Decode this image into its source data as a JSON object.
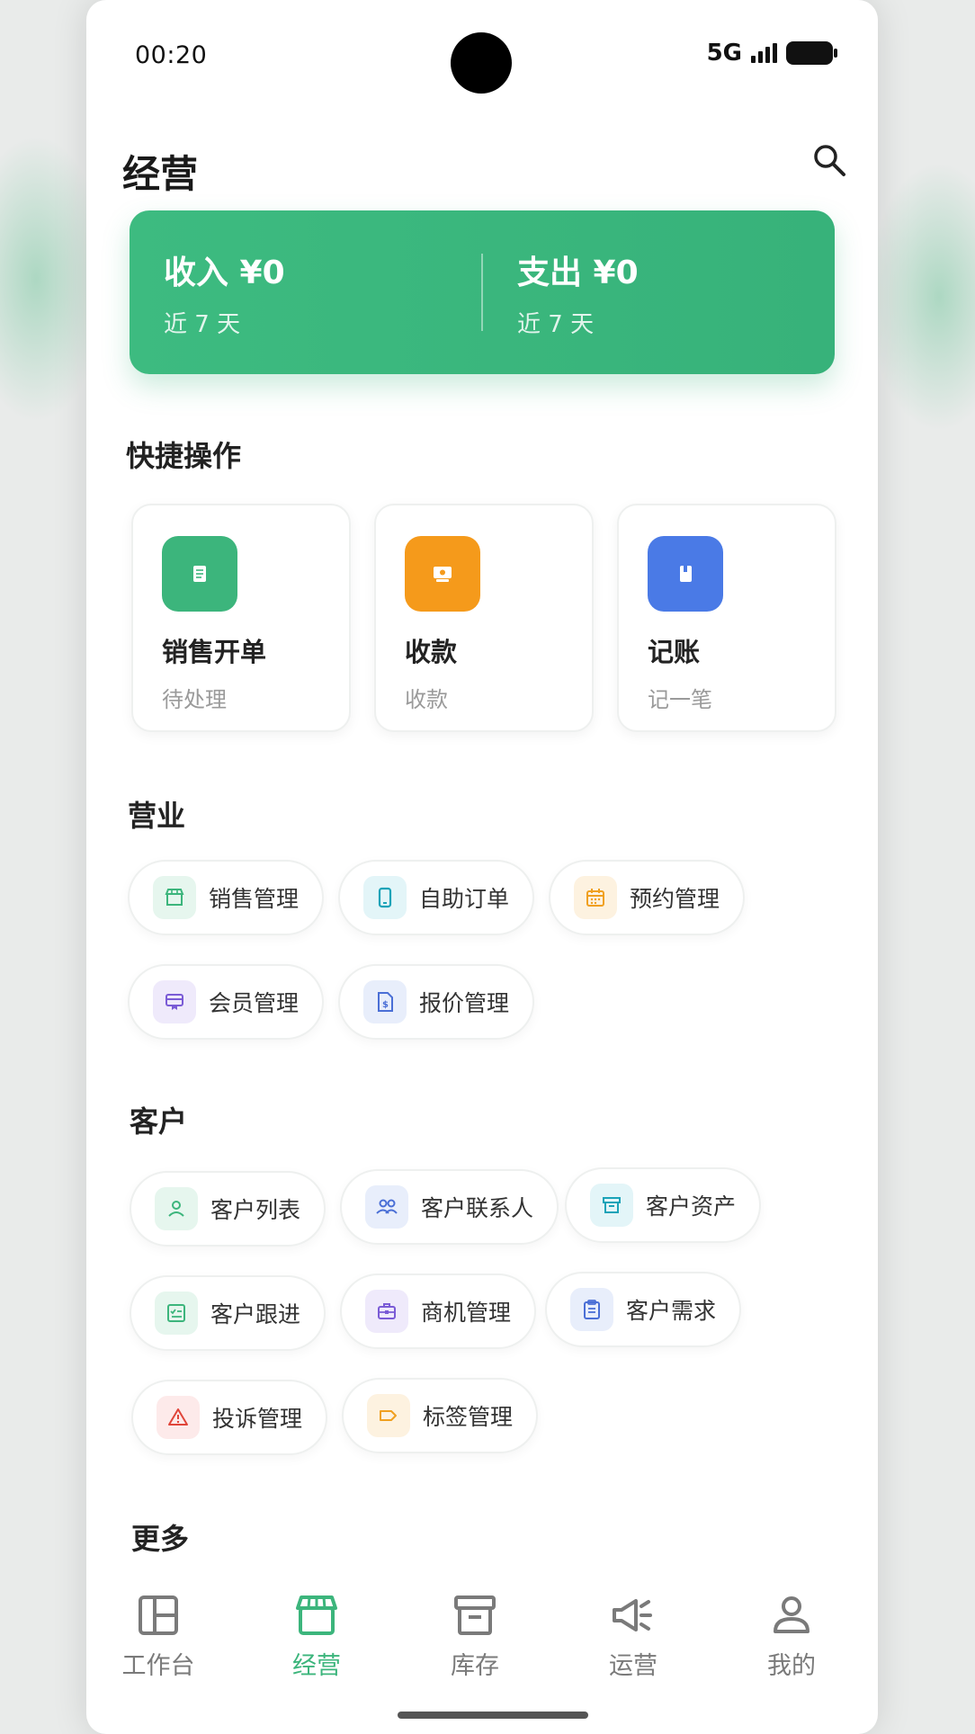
{
  "status_bar": {
    "time": "00:20",
    "network": "5G"
  },
  "header": {
    "title": "经营"
  },
  "summary": {
    "income_label": "收入 ¥0",
    "income_period": "近 7 天",
    "expense_label": "支出 ¥0",
    "expense_period": "近 7 天"
  },
  "quick_actions": {
    "title": "快捷操作",
    "items": [
      {
        "label": "销售开单",
        "sub": "待处理",
        "color": "#3cb57c",
        "icon": "receipt-icon"
      },
      {
        "label": "收款",
        "sub": "收款",
        "color": "#f59a1b",
        "icon": "payment-icon"
      },
      {
        "label": "记账",
        "sub": "记一笔",
        "color": "#4a7ae6",
        "icon": "ledger-icon"
      }
    ]
  },
  "business": {
    "title": "营业",
    "items": [
      {
        "label": "销售管理",
        "icon": "store-icon",
        "color": "#3cb57c",
        "bg": "#e6f6ee"
      },
      {
        "label": "自助订单",
        "icon": "phone-icon",
        "color": "#1aa3b8",
        "bg": "#e3f5f8"
      },
      {
        "label": "预约管理",
        "icon": "calendar-icon",
        "color": "#f0a020",
        "bg": "#fdf2e0"
      },
      {
        "label": "会员管理",
        "icon": "member-card-icon",
        "color": "#7a5bd6",
        "bg": "#efeafb"
      },
      {
        "label": "报价管理",
        "icon": "quote-document-icon",
        "color": "#4a6fd6",
        "bg": "#e8eefb"
      }
    ]
  },
  "customer": {
    "title": "客户",
    "items": [
      {
        "label": "客户列表",
        "icon": "person-icon",
        "color": "#3cb57c",
        "bg": "#e6f6ee"
      },
      {
        "label": "客户联系人",
        "icon": "contacts-icon",
        "color": "#4a6fd6",
        "bg": "#e8eefb"
      },
      {
        "label": "客户资产",
        "icon": "archive-icon",
        "color": "#1aa3b8",
        "bg": "#e3f5f8"
      },
      {
        "label": "客户跟进",
        "icon": "checklist-icon",
        "color": "#3cb57c",
        "bg": "#e6f6ee"
      },
      {
        "label": "商机管理",
        "icon": "briefcase-icon",
        "color": "#7a5bd6",
        "bg": "#efeafb"
      },
      {
        "label": "客户需求",
        "icon": "clipboard-icon",
        "color": "#4a6fd6",
        "bg": "#e8eefb"
      },
      {
        "label": "投诉管理",
        "icon": "warning-icon",
        "color": "#e0453a",
        "bg": "#fdeaea"
      },
      {
        "label": "标签管理",
        "icon": "tag-icon",
        "color": "#f0a020",
        "bg": "#fdf2e0"
      }
    ]
  },
  "more": {
    "title": "更多"
  },
  "bottom_nav": {
    "items": [
      {
        "label": "工作台",
        "icon": "dashboard-icon",
        "active": false
      },
      {
        "label": "经营",
        "icon": "store-icon",
        "active": true
      },
      {
        "label": "库存",
        "icon": "inventory-icon",
        "active": false
      },
      {
        "label": "运营",
        "icon": "megaphone-icon",
        "active": false
      },
      {
        "label": "我的",
        "icon": "profile-icon",
        "active": false
      }
    ],
    "active_color": "#3cb57c",
    "inactive_color": "#7a7a7a"
  }
}
